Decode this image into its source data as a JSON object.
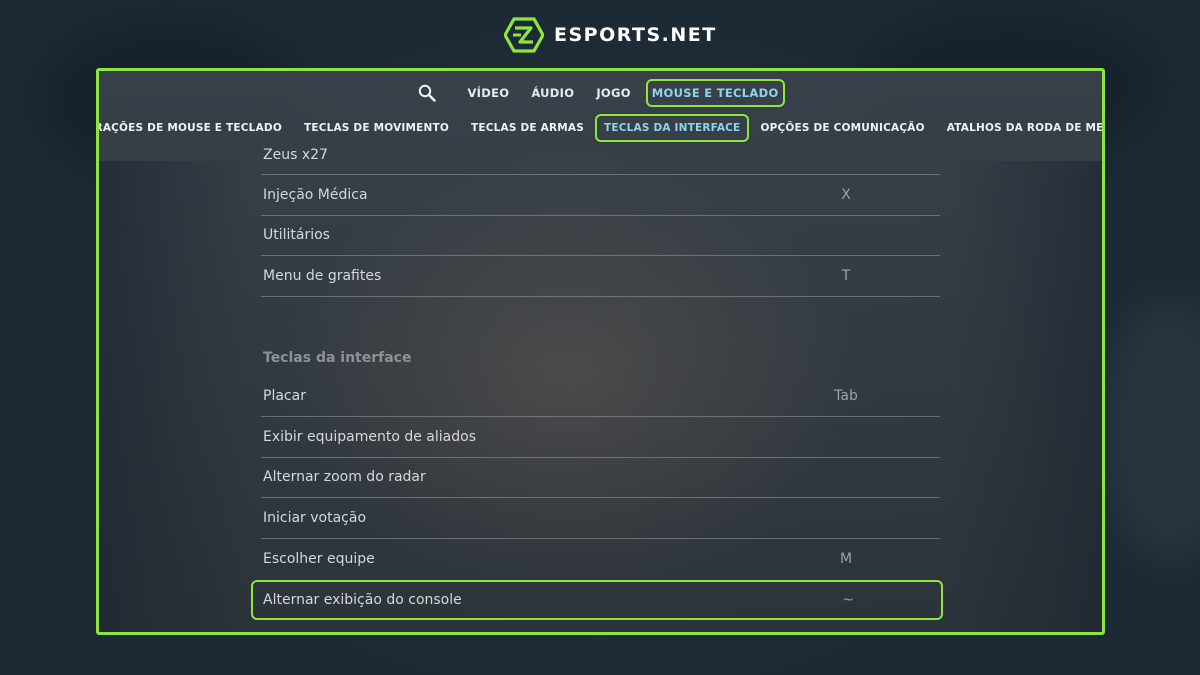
{
  "brand": {
    "name": "ESPORTS.NET",
    "logo_icon": "esports-net-logo-icon",
    "accent_color": "#8ee53f"
  },
  "topnav": {
    "search_icon": "search-icon",
    "items": [
      {
        "label": "VÍDEO"
      },
      {
        "label": "ÁUDIO"
      },
      {
        "label": "JOGO"
      },
      {
        "label": "MOUSE E TECLADO",
        "active": true
      }
    ]
  },
  "subnav": {
    "items": [
      {
        "label": "CONFIGURAÇÕES DE MOUSE E TECLADO"
      },
      {
        "label": "TECLAS DE MOVIMENTO"
      },
      {
        "label": "TECLAS DE ARMAS"
      },
      {
        "label": "TECLAS DA INTERFACE",
        "active": true
      },
      {
        "label": "OPÇÕES DE COMUNICAÇÃO"
      },
      {
        "label": "ATALHOS DA RODA DE MENSAGENS"
      }
    ]
  },
  "weapons_rows": [
    {
      "label": "Zeus x27",
      "key": ""
    },
    {
      "label": "Injeção Médica",
      "key": "X"
    },
    {
      "label": "Utilitários",
      "key": ""
    },
    {
      "label": "Menu de grafites",
      "key": "T"
    }
  ],
  "interface_section": {
    "title": "Teclas da interface",
    "rows": [
      {
        "label": "Placar",
        "key": "Tab"
      },
      {
        "label": "Exibir equipamento de aliados",
        "key": ""
      },
      {
        "label": "Alternar zoom do radar",
        "key": ""
      },
      {
        "label": "Iniciar votação",
        "key": ""
      },
      {
        "label": "Escolher equipe",
        "key": "M"
      },
      {
        "label": "Alternar exibição do console",
        "key": "~",
        "highlighted": true
      }
    ]
  }
}
